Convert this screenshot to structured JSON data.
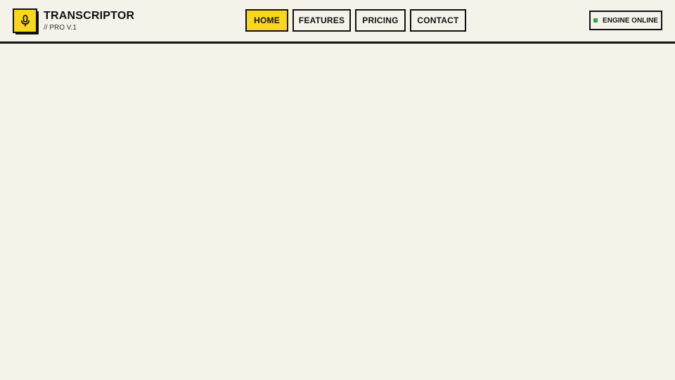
{
  "brand": {
    "title": "TRANSCRIPTOR",
    "subtitle": "// PRO V.1",
    "logo_icon": "microphone-icon",
    "accent_color": "#f9d71c"
  },
  "nav": {
    "items": [
      {
        "label": "HOME",
        "active": true
      },
      {
        "label": "FEATURES",
        "active": false
      },
      {
        "label": "PRICING",
        "active": false
      },
      {
        "label": "CONTACT",
        "active": false
      }
    ]
  },
  "status": {
    "label": "ENGINE ONLINE",
    "color": "#22b04b"
  }
}
